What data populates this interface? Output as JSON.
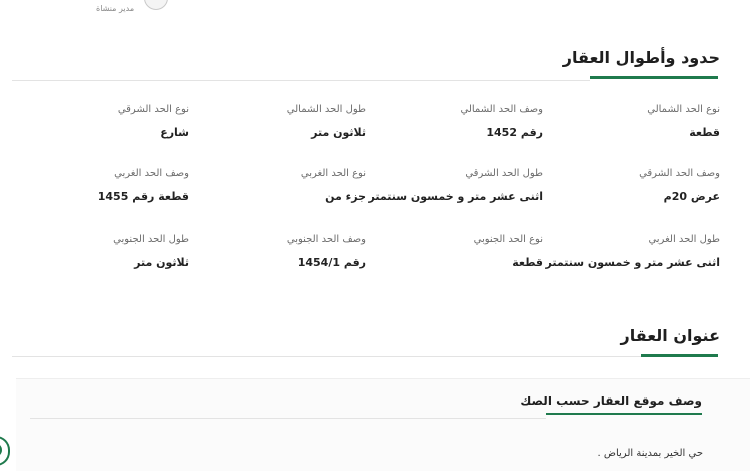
{
  "header": {
    "manager_label": "مدير منشاة"
  },
  "boundaries": {
    "title": "حدود وأطوال العقار",
    "fields": [
      {
        "label": "نوع الحد الشمالي",
        "value": "قطعة"
      },
      {
        "label": "وصف الحد الشمالي",
        "value": "رقم 1452"
      },
      {
        "label": "طول الحد الشمالي",
        "value": "ثلاثون متر"
      },
      {
        "label": "نوع الحد الشرقي",
        "value": "شارع"
      },
      {
        "label": "وصف الحد الشرقي",
        "value": "عرض 20م"
      },
      {
        "label": "طول الحد الشرقي",
        "value": "اثنى عشر متر و خمسون سنتمتر"
      },
      {
        "label": "نوع الحد الغربي",
        "value": "جزء من"
      },
      {
        "label": "وصف الحد الغربي",
        "value": "قطعة رقم 1455"
      },
      {
        "label": "طول الحد الغربي",
        "value": "اثنى عشر متر و خمسون سنتمتر"
      },
      {
        "label": "نوع الحد الجنوبي",
        "value": "قطعة"
      },
      {
        "label": "وصف الحد الجنوبي",
        "value": "رقم 1454/1"
      },
      {
        "label": "طول الحد الجنوبي",
        "value": "ثلاثون متر"
      }
    ]
  },
  "address": {
    "title": "عنوان العقار",
    "deed_location_title": "وصف موقع العقار حسب الصك",
    "deed_location_text": "حي الخير بمدينة الرياض ."
  },
  "colors": {
    "accent": "#1f7a4d"
  }
}
